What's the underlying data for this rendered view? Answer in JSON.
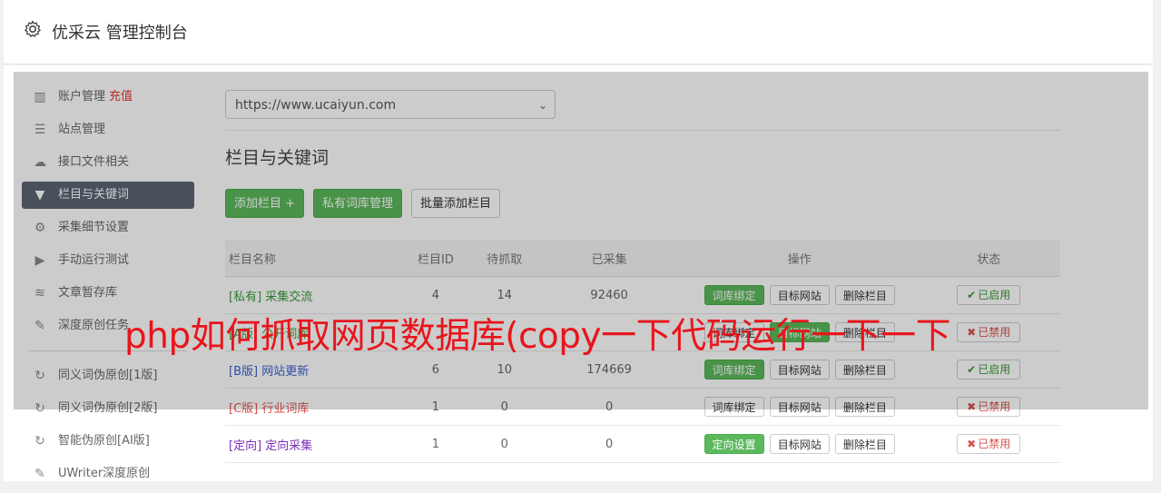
{
  "app": {
    "title": "优采云 管理控制台"
  },
  "sidebar": {
    "items": [
      {
        "icon": "bar-chart-icon",
        "label": "账户管理",
        "badge": "充值"
      },
      {
        "icon": "server-icon",
        "label": "站点管理"
      },
      {
        "icon": "cloud-upload-icon",
        "label": "接口文件相关"
      },
      {
        "icon": "filter-icon",
        "label": "栏目与关键词",
        "active": true
      },
      {
        "icon": "cogs-icon",
        "label": "采集细节设置"
      },
      {
        "icon": "play-circle-icon",
        "label": "手动运行测试"
      },
      {
        "icon": "database-icon",
        "label": "文章暂存库"
      },
      {
        "icon": "edit-icon",
        "label": "深度原创任务"
      }
    ],
    "items2": [
      {
        "icon": "refresh-icon",
        "label": "同义词伪原创[1版]"
      },
      {
        "icon": "refresh-icon",
        "label": "同义词伪原创[2版]"
      },
      {
        "icon": "refresh-icon",
        "label": "智能伪原创[AI版]"
      },
      {
        "icon": "edit-icon",
        "label": "UWriter深度原创"
      }
    ]
  },
  "site_select": {
    "value": "https://www.ucaiyun.com"
  },
  "section": {
    "title": "栏目与关键词"
  },
  "buttons": {
    "add_column": "添加栏目 +",
    "private_lib": "私有词库管理",
    "batch_add": "批量添加栏目"
  },
  "table": {
    "headers": [
      "栏目名称",
      "栏目ID",
      "待抓取",
      "已采集",
      "操作",
      "状态"
    ],
    "rows": [
      {
        "tag": "[私有]",
        "name": "采集交流",
        "id": "4",
        "pending": "14",
        "collected": "92460",
        "op1": "词库绑定",
        "op2": "目标网站",
        "op3": "删除栏目",
        "status": "已启用",
        "state": "on"
      },
      {
        "tag": "[A版]",
        "name": "公开词库",
        "id": "",
        "pending": "",
        "collected": "",
        "op1": "词库绑定",
        "op2": "目标网站",
        "op3": "删除栏目",
        "status": "已禁用",
        "state": "off"
      },
      {
        "tag": "[B版]",
        "name": "网站更新",
        "id": "6",
        "pending": "10",
        "collected": "174669",
        "op1": "词库绑定",
        "op2": "目标网站",
        "op3": "删除栏目",
        "status": "已启用",
        "state": "on"
      },
      {
        "tag": "[C版]",
        "name": "行业词库",
        "id": "1",
        "pending": "0",
        "collected": "0",
        "op1": "词库绑定",
        "op2": "目标网站",
        "op3": "删除栏目",
        "status": "已禁用",
        "state": "off"
      },
      {
        "tag": "[定向]",
        "name": "定向采集",
        "id": "1",
        "pending": "0",
        "collected": "0",
        "op1": "定向设置",
        "op2": "目标网站",
        "op3": "删除栏目",
        "status": "已禁用",
        "state": "off"
      }
    ]
  },
  "overlay_headline": "php如何抓取网页数据库(copy一下代码运行一下一下",
  "colors": {
    "accent_green": "#5cb85c",
    "active_nav": "#5a6573",
    "headline_red": "#e8151c"
  }
}
